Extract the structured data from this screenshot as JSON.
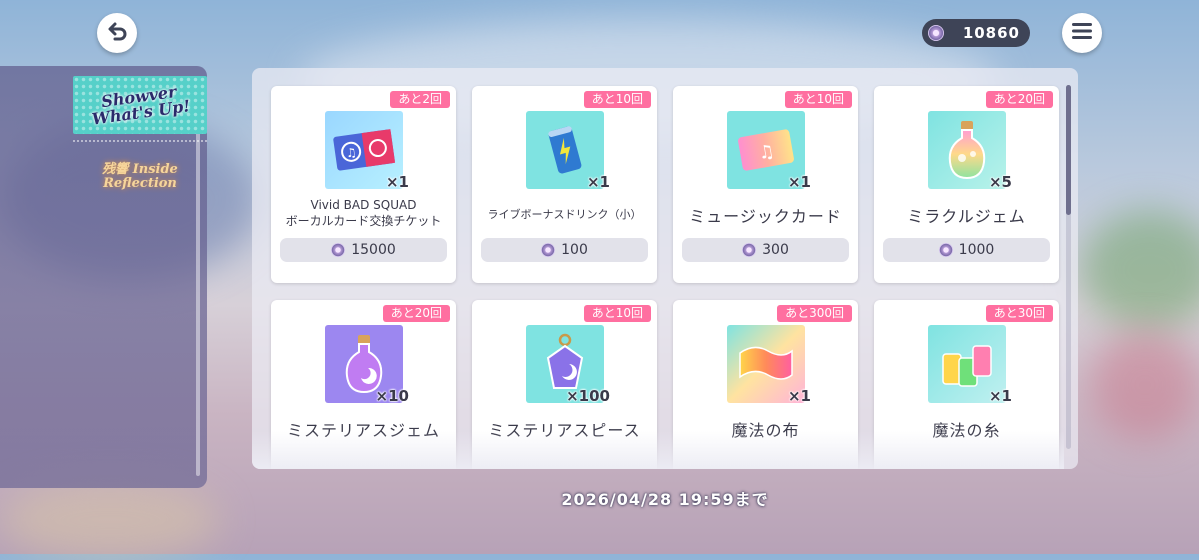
{
  "header": {
    "back_icon": "back-arrow-icon",
    "menu_icon": "hamburger-menu-icon",
    "currency": {
      "icon": "event-coin-icon",
      "amount": "10860"
    }
  },
  "sidebar": {
    "tabs": [
      {
        "label": "Showver What's Up!",
        "active": true
      },
      {
        "label": "残響 Inside Reflection",
        "active": false
      }
    ]
  },
  "shop": {
    "items": [
      {
        "badge": "あと2回",
        "name_line1": "Vivid BAD SQUAD",
        "name_line2": "ボーカルカード交換チケット",
        "qty": "×1",
        "price": "15000",
        "icon": "vocal-card-ticket-icon"
      },
      {
        "badge": "あと10回",
        "name": "ライブボーナスドリンク（小）",
        "qty": "×1",
        "price": "100",
        "icon": "live-bonus-drink-icon"
      },
      {
        "badge": "あと10回",
        "name": "ミュージックカード",
        "qty": "×1",
        "price": "300",
        "icon": "music-card-icon"
      },
      {
        "badge": "あと20回",
        "name": "ミラクルジェム",
        "qty": "×5",
        "price": "1000",
        "icon": "miracle-gem-bottle-icon"
      },
      {
        "badge": "あと20回",
        "name": "ミステリアスジェム",
        "qty": "×10",
        "icon": "mysterious-gem-bottle-icon"
      },
      {
        "badge": "あと10回",
        "name": "ミステリアスピース",
        "qty": "×100",
        "icon": "mysterious-piece-icon"
      },
      {
        "badge": "あと300回",
        "name": "魔法の布",
        "qty": "×1",
        "icon": "magic-cloth-icon"
      },
      {
        "badge": "あと30回",
        "name": "魔法の糸",
        "qty": "×1",
        "icon": "magic-thread-icon"
      }
    ]
  },
  "footer": {
    "deadline": "2026/04/28 19:59まで"
  },
  "colors": {
    "badge": "#ff6fa0",
    "active_tab": "#56d0c9",
    "coin_pill": "#3e4457"
  }
}
